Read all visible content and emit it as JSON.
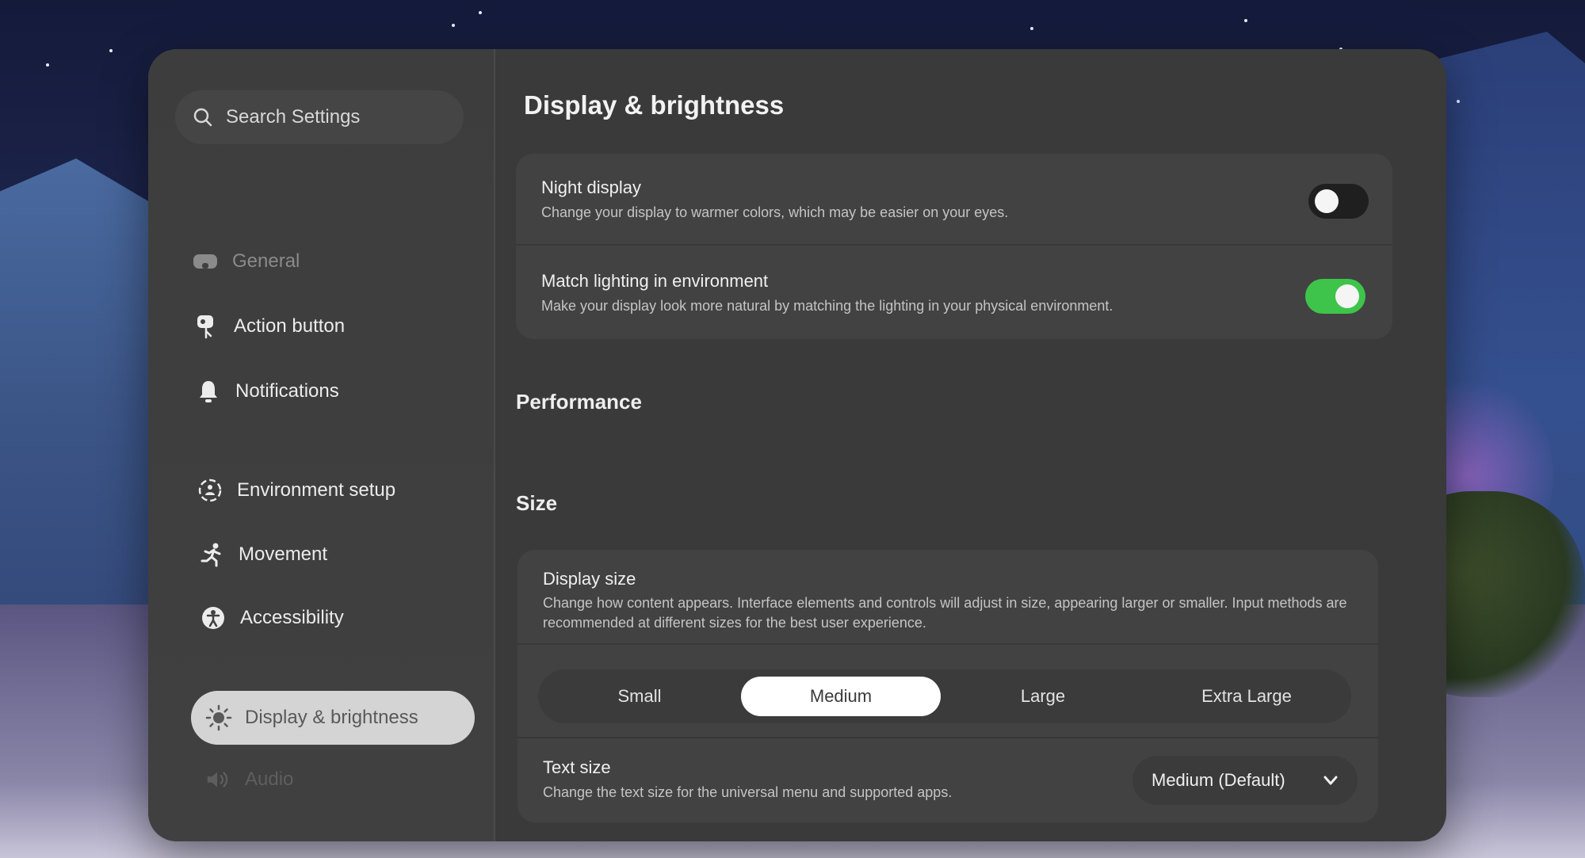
{
  "sidebar": {
    "search_placeholder": "Search Settings",
    "items": [
      {
        "label": "General",
        "icon": "headset-icon",
        "state": "dimmed"
      },
      {
        "label": "Action button",
        "icon": "action-button-icon"
      },
      {
        "label": "Notifications",
        "icon": "bell-icon"
      },
      {
        "label": "Environment setup",
        "icon": "environment-icon"
      },
      {
        "label": "Movement",
        "icon": "running-person-icon"
      },
      {
        "label": "Accessibility",
        "icon": "accessibility-icon"
      },
      {
        "label": "Display & brightness",
        "icon": "sun-icon",
        "state": "selected"
      },
      {
        "label": "Audio",
        "icon": "speaker-icon",
        "state": "faded"
      }
    ]
  },
  "main": {
    "title": "Display & brightness",
    "night_display": {
      "title": "Night display",
      "description": "Change your display to warmer colors, which may be easier on your eyes.",
      "enabled": false
    },
    "match_lighting": {
      "title": "Match lighting in environment",
      "description": "Make your display look more natural by matching the lighting in your physical environment.",
      "enabled": true
    },
    "performance_heading": "Performance",
    "size_heading": "Size",
    "display_size": {
      "title": "Display size",
      "description": "Change how content appears. Interface elements and controls will adjust in size, appearing larger or smaller. Input methods are recommended at different sizes for the best user experience.",
      "options": [
        "Small",
        "Medium",
        "Large",
        "Extra Large"
      ],
      "selected": "Medium"
    },
    "text_size": {
      "title": "Text size",
      "description": "Change the text size for the universal menu and supported apps.",
      "value": "Medium (Default)"
    }
  },
  "colors": {
    "toggle_on": "#3ec44a",
    "toggle_off": "#1f1f1f",
    "panel": "#3a3a3a",
    "selected_nav": "#d4d4d4"
  }
}
